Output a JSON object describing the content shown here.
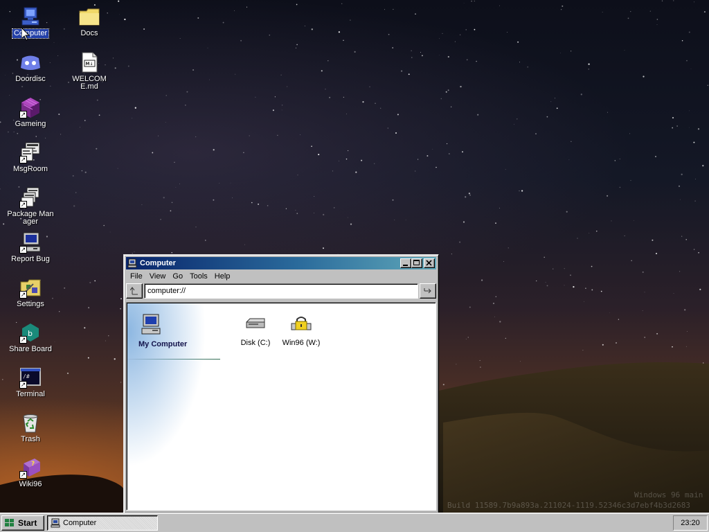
{
  "desktop": {
    "icons": [
      {
        "label": "Computer",
        "icon": "computer-icon"
      },
      {
        "label": "Docs",
        "icon": "folder-icon"
      },
      {
        "label": "Doordisc",
        "icon": "doordisc-icon"
      },
      {
        "label": "WELCOME.md",
        "icon": "markdown-file-icon"
      },
      {
        "label": "Gameing",
        "icon": "game-cube-icon"
      },
      {
        "label": "MsgRoom",
        "icon": "chat-room-icon"
      },
      {
        "label": "Package Manager",
        "icon": "package-manager-icon"
      },
      {
        "label": "Report Bug",
        "icon": "report-bug-icon"
      },
      {
        "label": "Settings",
        "icon": "settings-folder-icon"
      },
      {
        "label": "Share Board",
        "icon": "share-board-icon"
      },
      {
        "label": "Terminal",
        "icon": "terminal-icon"
      },
      {
        "label": "Trash",
        "icon": "recycle-bin-icon"
      },
      {
        "label": "Wiki96",
        "icon": "help-book-icon"
      }
    ],
    "watermark_line1": "Windows 96 main",
    "watermark_line2": "Build 11589.7b9a893a.211024-1119.52346c3d7ebf4b3d2683"
  },
  "window": {
    "title": "Computer",
    "menu": [
      "File",
      "View",
      "Go",
      "Tools",
      "Help"
    ],
    "address": "computer://",
    "up_icon": "up-arrow-icon",
    "go_icon": "go-arrow-icon",
    "side_title": "My Computer",
    "drives": [
      {
        "label": "Disk (C:)",
        "icon": "hard-disk-icon"
      },
      {
        "label": "Win96 (W:)",
        "icon": "locked-drive-icon"
      }
    ]
  },
  "taskbar": {
    "start_label": "Start",
    "task_label": "Computer",
    "clock": "23:20"
  },
  "colors": {
    "title_gradient_start": "#08246b",
    "title_gradient_end": "#5fa7b9",
    "selection": "#2340a8",
    "face": "#c0c0c0"
  }
}
